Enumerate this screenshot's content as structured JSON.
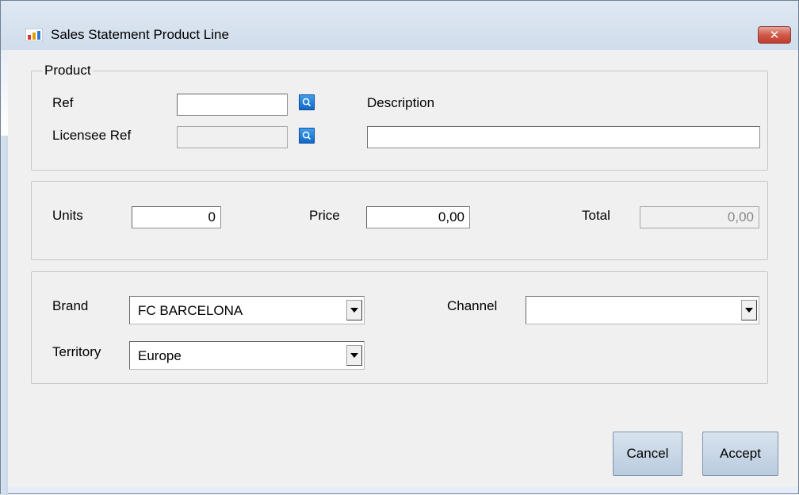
{
  "window": {
    "title": "Sales Statement Product Line",
    "close_label": "✕"
  },
  "product": {
    "legend": "Product",
    "ref_label": "Ref",
    "ref_value": "",
    "licensee_ref_label": "Licensee Ref",
    "licensee_ref_value": "",
    "description_label": "Description",
    "description_value": ""
  },
  "amounts": {
    "units_label": "Units",
    "units_value": "0",
    "price_label": "Price",
    "price_value": "0,00",
    "total_label": "Total",
    "total_value": "0,00"
  },
  "classification": {
    "brand_label": "Brand",
    "brand_value": "FC BARCELONA",
    "territory_label": "Territory",
    "territory_value": "Europe",
    "channel_label": "Channel",
    "channel_value": ""
  },
  "actions": {
    "cancel_label": "Cancel",
    "accept_label": "Accept"
  },
  "colors": {
    "window_frame": "#e6edf6",
    "client_bg": "#f0f0f0",
    "close_button": "#c23a2a",
    "lookup_button": "#1167c8",
    "button_face": "#c8d6e6"
  },
  "icons": {
    "app": "app-icon",
    "lookup": "magnifier-icon",
    "dropdown": "chevron-down-icon",
    "close": "close-icon"
  }
}
